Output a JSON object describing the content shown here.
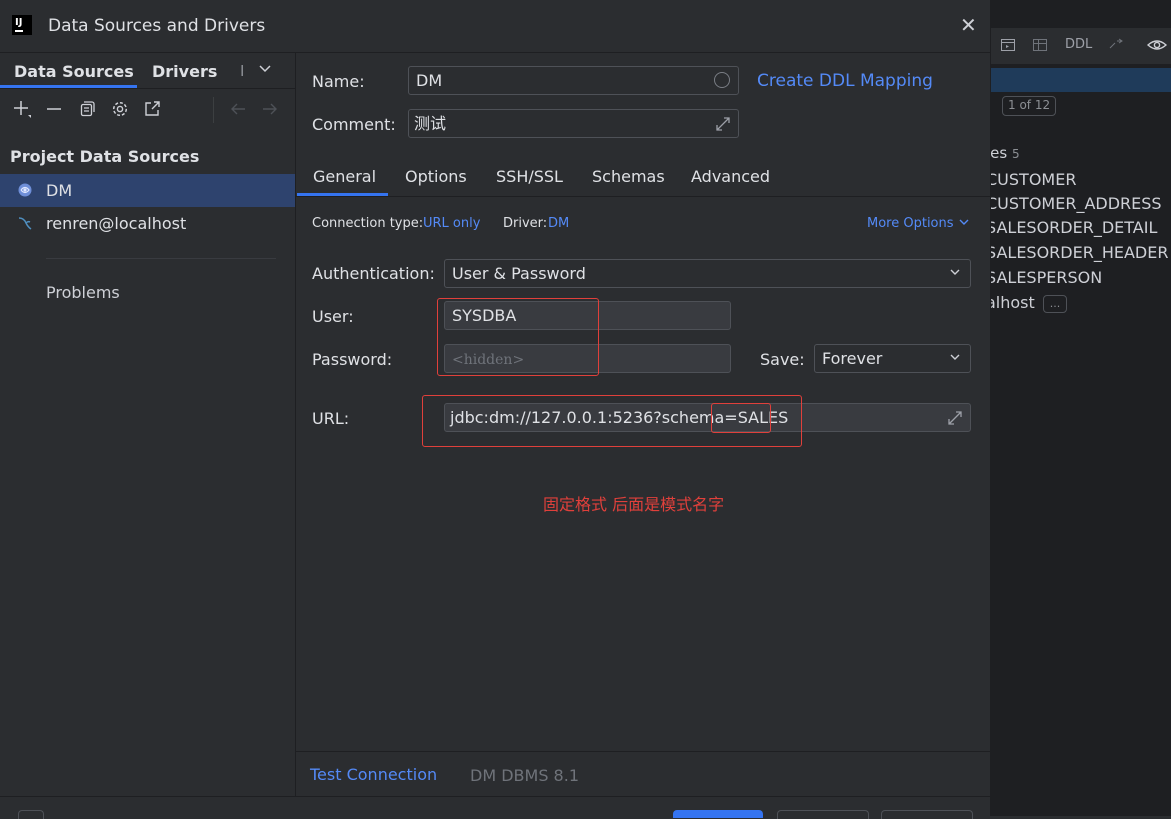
{
  "dialog": {
    "title": "Data Sources and Drivers",
    "close_icon": "close-icon"
  },
  "left": {
    "tabs": [
      "Data Sources",
      "Drivers",
      "I"
    ],
    "toolbar_icons": [
      "add-icon",
      "remove-icon",
      "duplicate-icon",
      "settings-icon",
      "export-icon",
      "back-arrow-icon",
      "forward-arrow-icon"
    ],
    "section_title": "Project Data Sources",
    "data_sources": [
      {
        "label": "DM",
        "icon": "dm-database-icon",
        "selected": true
      },
      {
        "label": "renren@localhost",
        "icon": "mysql-dolphin-icon",
        "selected": false
      }
    ],
    "problems_label": "Problems"
  },
  "form": {
    "name_label": "Name:",
    "name_value": "DM",
    "create_ddl_label": "Create DDL Mapping",
    "comment_label": "Comment:",
    "comment_value": "测试",
    "tabs": [
      "General",
      "Options",
      "SSH/SSL",
      "Schemas",
      "Advanced"
    ],
    "active_tab": "General",
    "connection_type_label": "Connection type:",
    "connection_type_value": "URL only",
    "driver_label": "Driver:",
    "driver_value": "DM",
    "more_options_label": "More Options",
    "auth_label": "Authentication:",
    "auth_value": "User & Password",
    "user_label": "User:",
    "user_value": "SYSDBA",
    "password_label": "Password:",
    "password_placeholder": "<hidden>",
    "save_label": "Save:",
    "save_value": "Forever",
    "url_label": "URL:",
    "url_prefix": "jdbc:dm://127.0.0.1:5236?schema=",
    "url_schema": "SALES",
    "annotation": "固定格式 后面是模式名字",
    "test_connection_label": "Test Connection",
    "dbms_version": "DM DBMS 8.1"
  },
  "background_ide": {
    "toolbar_ddl": "DDL",
    "pager": "1 of 12",
    "tables_label": "les",
    "tables_count": "5",
    "tables": [
      "CUSTOMER",
      "CUSTOMER_ADDRESS",
      "SALESORDER_DETAIL",
      "SALESORDER_HEADER",
      "SALESPERSON"
    ],
    "host_fragment": "alhost",
    "ellipsis": "..."
  },
  "colors": {
    "accent": "#3574f0",
    "link": "#548af7",
    "annotation_red": "#e0403b",
    "selection": "#2e436e"
  }
}
